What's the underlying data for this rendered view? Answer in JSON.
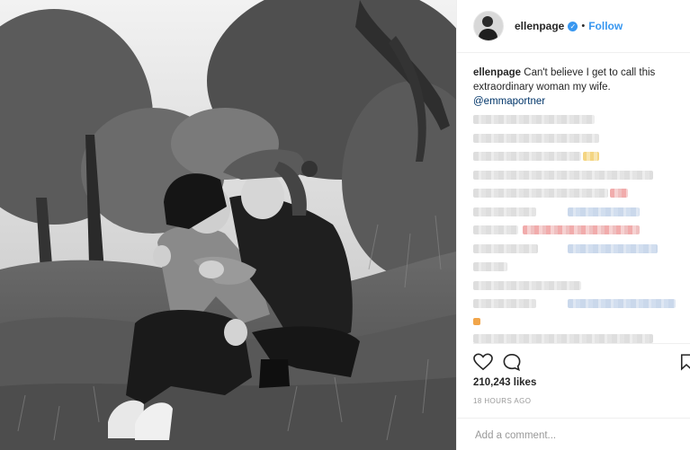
{
  "post": {
    "username": "ellenpage",
    "follow_label": "Follow",
    "caption_user": "ellenpage",
    "caption_text": "Can't believe I get to call this extraordinary woman my wife.",
    "mention": "@emmaportner",
    "likes": "210,243 likes",
    "time": "18 HOURS AGO",
    "comment_placeholder": "Add a comment...",
    "photo_description": "Black and white photo of two people kissing while sitting on a grassy hillside among trees"
  },
  "icons": {
    "like": "heart-icon",
    "comment": "comment-bubble-icon",
    "save": "bookmark-icon",
    "verified": "verified-badge-icon"
  },
  "colors": {
    "accent": "#3897f0",
    "mention": "#003569",
    "text": "#262626",
    "muted": "#999999"
  }
}
